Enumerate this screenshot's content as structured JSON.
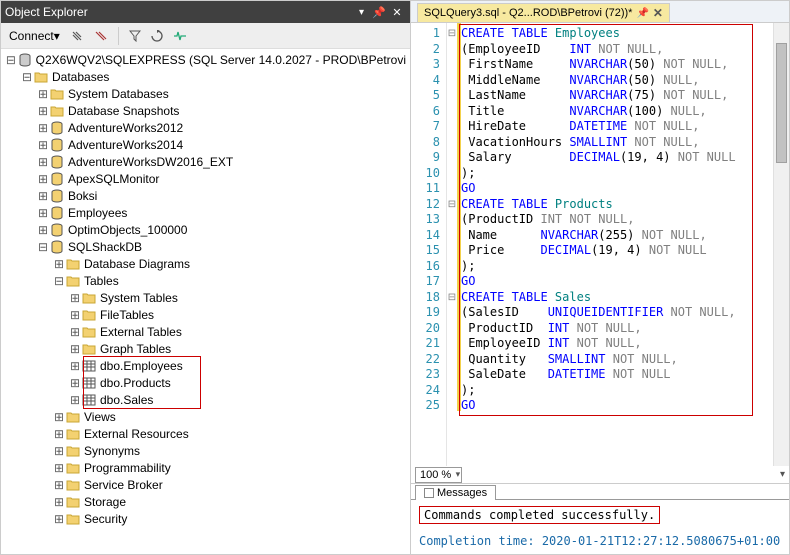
{
  "explorer": {
    "title": "Object Explorer",
    "connect_label": "Connect",
    "server_label": "Q2X6WQV2\\SQLEXPRESS (SQL Server 14.0.2027 - PROD\\BPetrovi",
    "databases_label": "Databases",
    "db_items": [
      "System Databases",
      "Database Snapshots",
      "AdventureWorks2012",
      "AdventureWorks2014",
      "AdventureWorksDW2016_EXT",
      "ApexSQLMonitor",
      "Boksi",
      "Employees",
      "OptimObjects_100000"
    ],
    "current_db": "SQLShackDB",
    "db_children": [
      "Database Diagrams"
    ],
    "tables_label": "Tables",
    "table_folders": [
      "System Tables",
      "FileTables",
      "External Tables",
      "Graph Tables"
    ],
    "tables": [
      "dbo.Employees",
      "dbo.Products",
      "dbo.Sales"
    ],
    "after_tables": [
      "Views",
      "External Resources",
      "Synonyms",
      "Programmability",
      "Service Broker",
      "Storage",
      "Security"
    ]
  },
  "tab": {
    "label": "SQLQuery3.sql - Q2...ROD\\BPetrovi (72))*"
  },
  "code": [
    {
      "t": "CREATE TABLE ",
      "k": "kw",
      "t2": "Employees",
      "k2": "obj"
    },
    {
      "raw": "(EmployeeID    ",
      "t": "INT NOT NULL",
      "k": "gray",
      "pre": ""
    },
    {
      "pref": " FirstName     ",
      "t": "NVARCHAR",
      "k": "typ",
      "rest": "(50) ",
      "g": "NOT NULL,",
      "gk": "gray"
    },
    {
      "pref": " MiddleName    ",
      "t": "NVARCHAR",
      "k": "typ",
      "rest": "(50) ",
      "g": "NULL,",
      "gk": "gray"
    },
    {
      "pref": " LastName      ",
      "t": "NVARCHAR",
      "k": "typ",
      "rest": "(75) ",
      "g": "NOT NULL,",
      "gk": "gray"
    },
    {
      "pref": " Title         ",
      "t": "NVARCHAR",
      "k": "typ",
      "rest": "(100) ",
      "g": "NULL,",
      "gk": "gray"
    },
    {
      "pref": " HireDate      ",
      "t": "DATETIME ",
      "k": "typ",
      "g": "NOT NULL,",
      "gk": "gray"
    },
    {
      "pref": " VacationHours ",
      "t": "SMALLINT ",
      "k": "typ",
      "g": "NOT NULL,",
      "gk": "gray"
    },
    {
      "pref": " Salary        ",
      "t": "DECIMAL",
      "k": "typ",
      "rest": "(19, 4) ",
      "g": "NOT NULL",
      "gk": "gray"
    },
    {
      "pref": ");",
      "plain": true
    },
    {
      "t": "GO",
      "k": "kw"
    },
    {
      "t": "CREATE TABLE ",
      "k": "kw",
      "t2": "Products",
      "k2": "obj"
    },
    {
      "pref": "(ProductID ",
      "t": "INT NOT NULL",
      "k": "gray",
      "g": ",",
      "gk": "gray",
      "intblue": true
    },
    {
      "pref": " Name      ",
      "t": "NVARCHAR",
      "k": "typ",
      "rest": "(255) ",
      "g": "NOT NULL,",
      "gk": "gray"
    },
    {
      "pref": " Price     ",
      "t": "DECIMAL",
      "k": "typ",
      "rest": "(19, 4) ",
      "g": "NOT NULL",
      "gk": "gray"
    },
    {
      "pref": ");",
      "plain": true
    },
    {
      "t": "GO",
      "k": "kw"
    },
    {
      "t": "CREATE TABLE ",
      "k": "kw",
      "t2": "Sales",
      "k2": "obj"
    },
    {
      "pref": "(SalesID    ",
      "t": "UNIQUEIDENTIFIER ",
      "k": "typ",
      "g": "NOT NULL,",
      "gk": "gray"
    },
    {
      "pref": " ProductID  ",
      "t": "INT ",
      "k": "typ",
      "g": "NOT NULL,",
      "gk": "gray"
    },
    {
      "pref": " EmployeeID ",
      "t": "INT ",
      "k": "typ",
      "g": "NOT NULL,",
      "gk": "gray"
    },
    {
      "pref": " Quantity   ",
      "t": "SMALLINT ",
      "k": "typ",
      "g": "NOT NULL,",
      "gk": "gray"
    },
    {
      "pref": " SaleDate   ",
      "t": "DATETIME ",
      "k": "typ",
      "g": "NOT NULL",
      "gk": "gray"
    },
    {
      "pref": ");",
      "plain": true
    },
    {
      "t": "GO",
      "k": "kw"
    }
  ],
  "zoom": "100 %",
  "messages": {
    "tab_label": "Messages",
    "success": "Commands completed successfully.",
    "time": "Completion time: 2020-01-21T12:27:12.5080675+01:00"
  }
}
